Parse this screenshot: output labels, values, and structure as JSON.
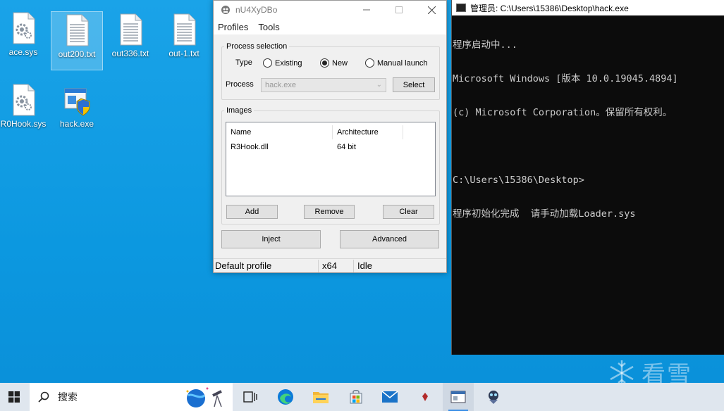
{
  "desktop": {
    "icons": [
      {
        "label": "ace.sys",
        "kind": "sys-file"
      },
      {
        "label": "out200.txt",
        "kind": "text-file"
      },
      {
        "label": "out336.txt",
        "kind": "text-file"
      },
      {
        "label": "out-1.txt",
        "kind": "text-file"
      },
      {
        "label": "R0Hook.sys",
        "kind": "sys-file"
      },
      {
        "label": "hack.exe",
        "kind": "exe-shield"
      }
    ]
  },
  "injector": {
    "title": "nU4XyDBo",
    "menu": [
      "Profiles",
      "Tools"
    ],
    "process_selection": {
      "legend": "Process selection",
      "type_label": "Type",
      "types": [
        "Existing",
        "New",
        "Manual launch"
      ],
      "selected_type": "New",
      "process_label": "Process",
      "process_value": "hack.exe",
      "select_button": "Select"
    },
    "images": {
      "legend": "Images",
      "columns": [
        "Name",
        "Architecture"
      ],
      "rows": [
        {
          "name": "R3Hook.dll",
          "arch": "64 bit"
        }
      ],
      "buttons": {
        "add": "Add",
        "remove": "Remove",
        "clear": "Clear"
      }
    },
    "inject_button": "Inject",
    "advanced_button": "Advanced",
    "status": {
      "profile": "Default profile",
      "arch": "x64",
      "state": "Idle"
    }
  },
  "console": {
    "title": "管理员: C:\\Users\\15386\\Desktop\\hack.exe",
    "lines": [
      "程序启动中...",
      "Microsoft Windows [版本 10.0.19045.4894]",
      "(c) Microsoft Corporation。保留所有权利。",
      "",
      "C:\\Users\\15386\\Desktop>",
      "程序初始化完成  请手动加载Loader.sys"
    ]
  },
  "watermark": "看雪",
  "taskbar": {
    "search_placeholder": "搜索",
    "apps": [
      "task-view",
      "edge",
      "file-explorer",
      "store",
      "mail",
      "app-red",
      "injector-app",
      "game-app"
    ]
  },
  "colors": {
    "desktop_bg": "#0c98e0",
    "console_bg": "#0c0c0c",
    "console_text": "#cccccc",
    "taskbar_bg": "#dfe6ee"
  }
}
